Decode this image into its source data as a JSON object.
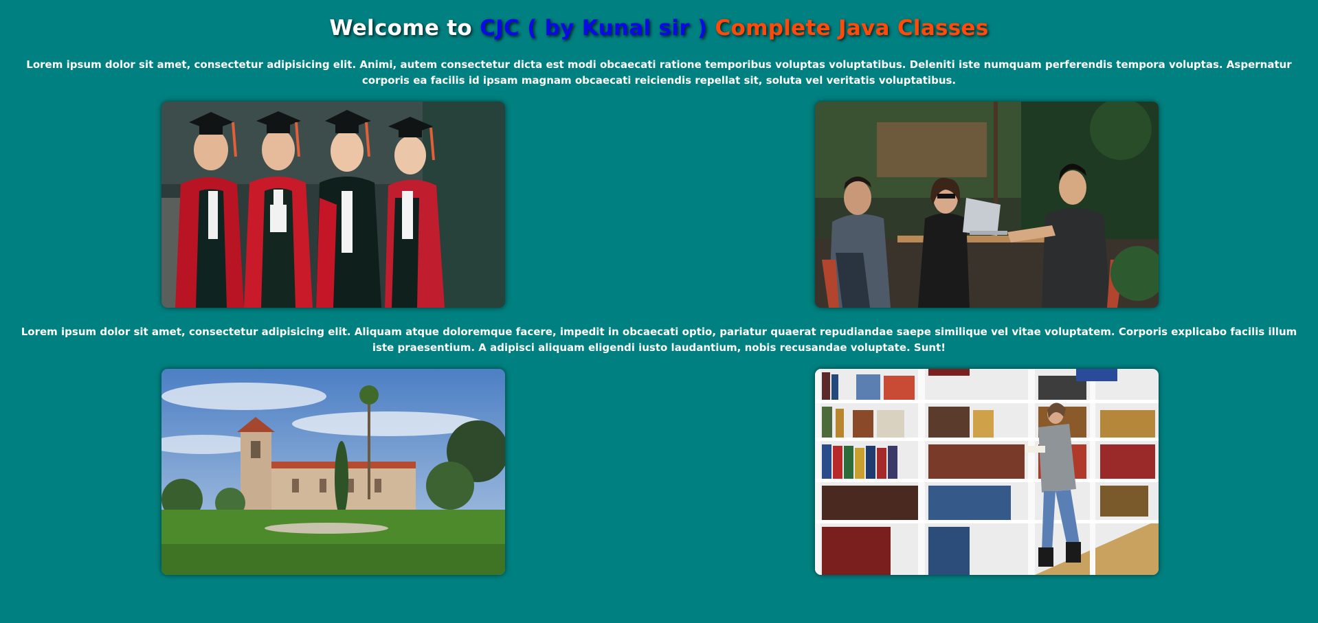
{
  "header": {
    "part1": "Welcome to",
    "part2": "CJC ( by Kunal sir )",
    "part3": "Complete Java Classes"
  },
  "paragraphs": {
    "p1": "Lorem ipsum dolor sit amet, consectetur adipisicing elit. Animi, autem consectetur dicta est modi obcaecati ratione temporibus voluptas voluptatibus. Deleniti iste numquam perferendis tempora voluptas. Aspernatur corporis ea facilis id ipsam magnam obcaecati reiciendis repellat sit, soluta vel veritatis voluptatibus.",
    "p2": "Lorem ipsum dolor sit amet, consectetur adipisicing elit. Aliquam atque doloremque facere, impedit in obcaecati optio, pariatur quaerat repudiandae saepe similique vel vitae voluptatem. Corporis explicabo facilis illum iste praesentium. A adipisci aliquam eligendi iusto laudantium, nobis recusandae voluptate. Sunt!"
  },
  "colors": {
    "background": "#008080",
    "title_white": "#ffffff",
    "title_blue": "#0a0ae6",
    "title_orange": "#ff4a0a"
  }
}
